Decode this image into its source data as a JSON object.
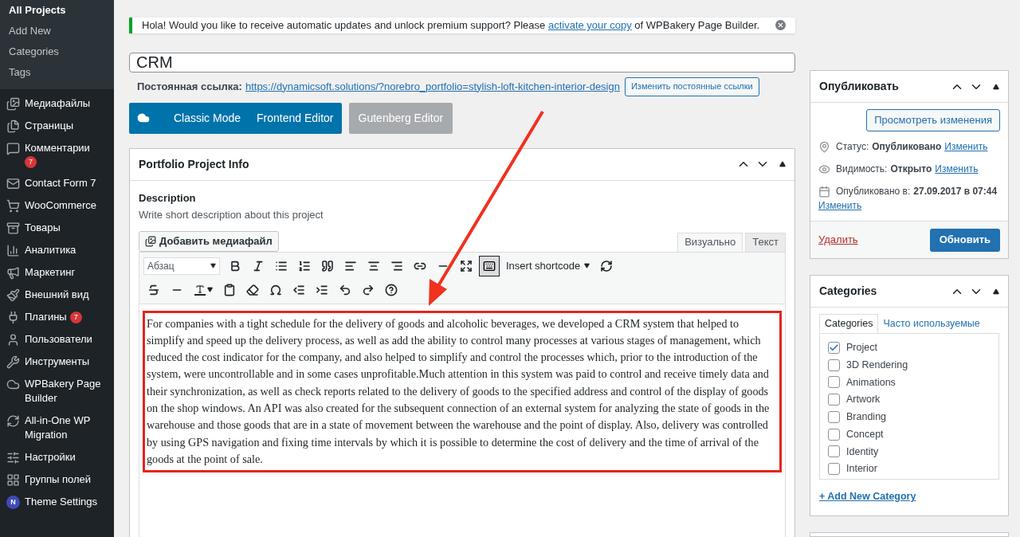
{
  "sidebar": {
    "submenu": [
      {
        "label": "All Projects",
        "selected": true
      },
      {
        "label": "Add New",
        "selected": false
      },
      {
        "label": "Categories",
        "selected": false
      },
      {
        "label": "Tags",
        "selected": false
      }
    ],
    "items": [
      {
        "label": "Медиафайлы"
      },
      {
        "label": "Страницы"
      },
      {
        "label": "Комментарии",
        "badge": "7",
        "badge_below": true
      },
      {
        "label": "Contact Form 7"
      },
      {
        "label": "WooCommerce"
      },
      {
        "label": "Товары"
      },
      {
        "label": "Аналитика"
      },
      {
        "label": "Маркетинг"
      },
      {
        "label": "Внешний вид"
      },
      {
        "label": "Плагины",
        "badge": "7",
        "badge_below": false
      },
      {
        "label": "Пользователи"
      },
      {
        "label": "Инструменты"
      },
      {
        "label": "WPBakery Page Builder"
      },
      {
        "label": "All-in-One WP Migration"
      },
      {
        "label": "Настройки"
      },
      {
        "label": "Группы полей"
      },
      {
        "label": "Theme Settings",
        "logo": "N"
      }
    ]
  },
  "notice": {
    "text_before": "Hola! Would you like to receive automatic updates and unlock premium support? Please ",
    "link": "activate your copy",
    "text_after": " of WPBakery Page Builder."
  },
  "title_field": {
    "value": "CRM"
  },
  "permalink": {
    "label": "Постоянная ссылка:",
    "url": "https://dynamicsoft.solutions/?norebro_portfolio=stylish-loft-kitchen-interior-design",
    "button": "Изменить постоянные ссылки"
  },
  "mode_buttons": [
    {
      "label": "Classic Mode",
      "disabled": false
    },
    {
      "label": "Frontend Editor",
      "disabled": false
    },
    {
      "label": "Gutenberg Editor",
      "disabled": true
    }
  ],
  "project_box": {
    "title": "Portfolio Project Info",
    "field_label": "Description",
    "field_hint": "Write short description about this project",
    "media_button": "Добавить медиафайл",
    "editor_tabs": [
      {
        "label": "Визуально",
        "selected": true
      },
      {
        "label": "Текст",
        "selected": false
      }
    ],
    "format_select": "Абзац",
    "shortcode_menu": "Insert shortcode",
    "content": "For companies with a tight schedule for the delivery of goods and alcoholic beverages, we developed a CRM system that helped to simplify and speed up the delivery process, as well as add the ability to control many processes at various stages of management, which reduced the cost indicator for the company, and also helped to simplify and control the processes which, prior to the introduction of the system, were uncontrollable and in some cases unprofitable.Much attention in this system was paid to control and receive timely data and their synchronization, as well as check reports related to the delivery of goods to the specified address and control of the display of goods on the shop windows. An API was also created for the subsequent connection of an external system for analyzing the state of goods in the warehouse and those goods that are in a state of movement between the warehouse and the point of display. Also, delivery was controlled by using GPS navigation and fixing time intervals by which it is possible to determine the cost of delivery and the time of arrival of the goods at the point of sale."
  },
  "publish_box": {
    "title": "Опубликовать",
    "preview_button": "Просмотреть изменения",
    "rows": [
      {
        "label": "Статус:",
        "value": "Опубликовано",
        "link": "Изменить"
      },
      {
        "label": "Видимость:",
        "value": "Открыто",
        "link": "Изменить"
      },
      {
        "label": "Опубликовано в:",
        "value": "27.09.2017 в 07:44",
        "link": "Изменить"
      }
    ],
    "delete_link": "Удалить",
    "update_button": "Обновить"
  },
  "categories_box": {
    "title": "Categories",
    "tabs": [
      {
        "label": "Categories",
        "selected": true
      },
      {
        "label": "Часто используемые",
        "selected": false
      }
    ],
    "items": [
      {
        "label": "Project",
        "checked": true
      },
      {
        "label": "3D Rendering",
        "checked": false
      },
      {
        "label": "Animations",
        "checked": false
      },
      {
        "label": "Artwork",
        "checked": false
      },
      {
        "label": "Branding",
        "checked": false
      },
      {
        "label": "Concept",
        "checked": false
      },
      {
        "label": "Identity",
        "checked": false
      },
      {
        "label": "Interior",
        "checked": false
      }
    ],
    "add_link": "+ Add New Category"
  }
}
